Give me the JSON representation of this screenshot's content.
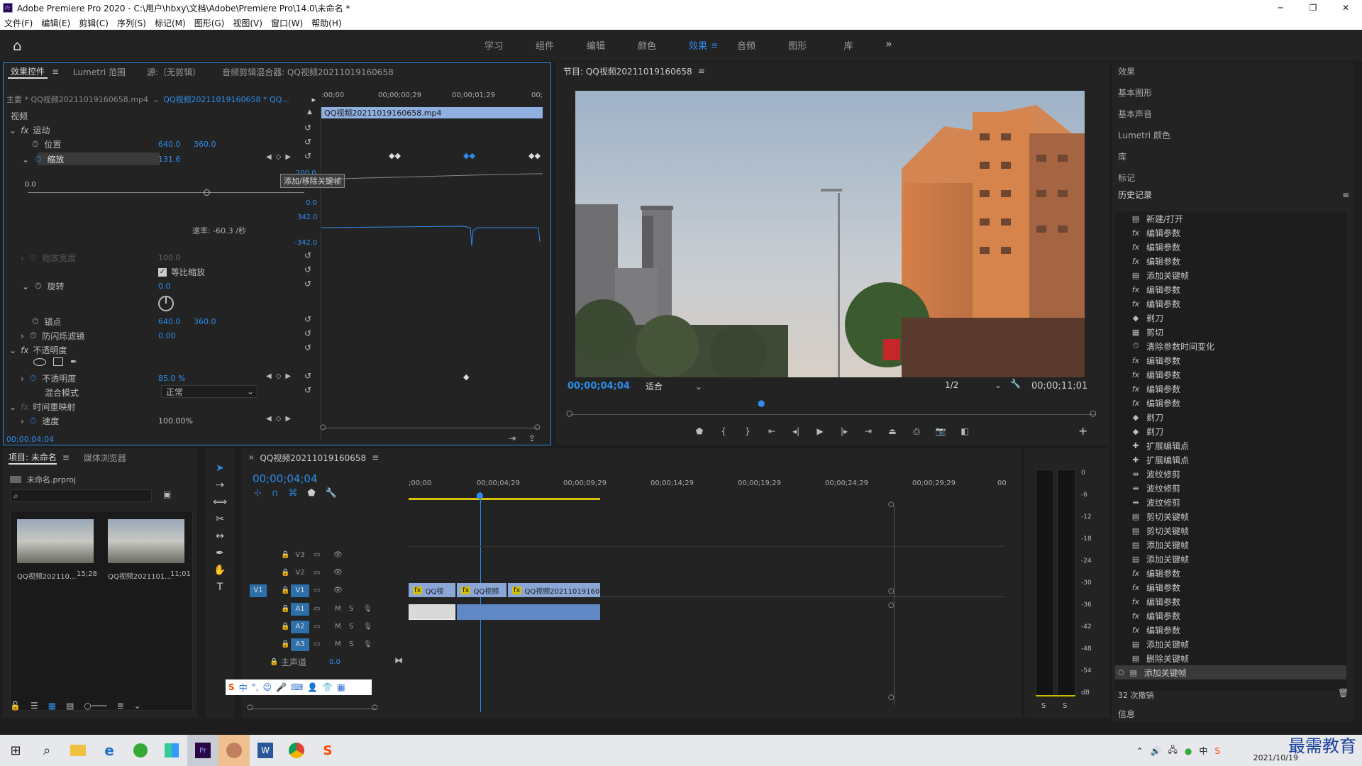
{
  "window": {
    "title": "Adobe Premiere Pro 2020 - C:\\用户\\hbxy\\文档\\Adobe\\Premiere Pro\\14.0\\未命名 *"
  },
  "menu": [
    "文件(F)",
    "编辑(E)",
    "剪辑(C)",
    "序列(S)",
    "标记(M)",
    "图形(G)",
    "视图(V)",
    "窗口(W)",
    "帮助(H)"
  ],
  "workspaces": [
    "学习",
    "组件",
    "编辑",
    "颜色",
    "效果",
    "音频",
    "图形",
    "库"
  ],
  "active_workspace": "效果",
  "effect_controls": {
    "tabs": [
      "效果控件",
      "Lumetri 范围",
      "源:（无剪辑）",
      "音频剪辑混合器: QQ视频20211019160658"
    ],
    "master": "主要 * QQ视频20211019160658.mp4",
    "clip": "QQ视频20211019160658 * QQ...",
    "ruler": [
      ":00;00",
      "00;00;00;29",
      "00;00;01;29",
      "00;"
    ],
    "clip_bar": "QQ视频20211019160658.mp4",
    "video_label": "视频",
    "motion": "运动",
    "position": {
      "label": "位置",
      "x": "640.0",
      "y": "360.0"
    },
    "scale": {
      "label": "缩放",
      "value": "131.6"
    },
    "graph": {
      "zero": "0.0",
      "v1": "0.0",
      "v2": "342.0",
      "v3": "-342.0",
      "top": "200.0",
      "rate": "速率: -60.3 /秒"
    },
    "tooltip": "添加/移除关键帧",
    "scale_width": {
      "label": "缩放宽度",
      "value": "100.0"
    },
    "uniform": "等比缩放",
    "rotation": {
      "label": "旋转",
      "value": "0.0"
    },
    "anchor": {
      "label": "锚点",
      "x": "640.0",
      "y": "360.0"
    },
    "flicker": {
      "label": "防闪烁滤镜",
      "value": "0.00"
    },
    "opacity_group": "不透明度",
    "opacity": {
      "label": "不透明度",
      "value": "85.0 %"
    },
    "blend": {
      "label": "混合模式",
      "value": "正常"
    },
    "remap": "时间重映射",
    "speed": {
      "label": "速度",
      "value": "100.00%"
    },
    "timecode": "00;00;04;04"
  },
  "program": {
    "title": "节目: QQ视频20211019160658",
    "timecode": "00;00;04;04",
    "fit": "适合",
    "res": "1/2",
    "duration": "00;00;11;01"
  },
  "right_panel": {
    "items": [
      "效果",
      "基本图形",
      "基本声音",
      "Lumetri 颜色",
      "库",
      "标记"
    ],
    "history_title": "历史记录",
    "history": [
      {
        "icon": "doc",
        "label": "新建/打开"
      },
      {
        "icon": "fx",
        "label": "编辑参数"
      },
      {
        "icon": "fx",
        "label": "编辑参数"
      },
      {
        "icon": "fx",
        "label": "编辑参数"
      },
      {
        "icon": "key",
        "label": "添加关键帧"
      },
      {
        "icon": "fx",
        "label": "编辑参数"
      },
      {
        "icon": "fx",
        "label": "编辑参数"
      },
      {
        "icon": "razor",
        "label": "剃刀"
      },
      {
        "icon": "cut",
        "label": "剪切"
      },
      {
        "icon": "clock",
        "label": "清除参数时间变化"
      },
      {
        "icon": "fx",
        "label": "编辑参数"
      },
      {
        "icon": "fx",
        "label": "编辑参数"
      },
      {
        "icon": "fx",
        "label": "编辑参数"
      },
      {
        "icon": "fx",
        "label": "编辑参数"
      },
      {
        "icon": "razor",
        "label": "剃刀"
      },
      {
        "icon": "razor",
        "label": "剃刀"
      },
      {
        "icon": "extend",
        "label": "扩展编辑点"
      },
      {
        "icon": "extend",
        "label": "扩展编辑点"
      },
      {
        "icon": "ripple",
        "label": "波纹修剪"
      },
      {
        "icon": "ripple",
        "label": "波纹修剪"
      },
      {
        "icon": "ripple",
        "label": "波纹修剪"
      },
      {
        "icon": "key",
        "label": "剪切关键帧"
      },
      {
        "icon": "key",
        "label": "剪切关键帧"
      },
      {
        "icon": "key",
        "label": "添加关键帧"
      },
      {
        "icon": "key",
        "label": "添加关键帧"
      },
      {
        "icon": "fx",
        "label": "编辑参数"
      },
      {
        "icon": "fx",
        "label": "编辑参数"
      },
      {
        "icon": "fx",
        "label": "编辑参数"
      },
      {
        "icon": "fx",
        "label": "编辑参数"
      },
      {
        "icon": "fx",
        "label": "编辑参数"
      },
      {
        "icon": "key",
        "label": "添加关键帧"
      },
      {
        "icon": "key",
        "label": "删除关键帧"
      },
      {
        "icon": "key",
        "label": "添加关键帧"
      }
    ],
    "undo": "32 次撤销",
    "info": "信息"
  },
  "project": {
    "tabs": [
      "项目: 未命名",
      "媒体浏览器"
    ],
    "file": "未命名.prproj",
    "clips": [
      {
        "name": "QQ视频202110...",
        "dur": "15;28"
      },
      {
        "name": "QQ视频2021101...",
        "dur": "11;01"
      }
    ]
  },
  "timeline": {
    "title": "QQ视频20211019160658",
    "timecode": "00;00;04;04",
    "ruler": [
      ";00;00",
      "00;00;04;29",
      "00;00;09;29",
      "00;00;14;29",
      "00;00;19;29",
      "00;00;24;29",
      "00;00;29;29",
      "00"
    ],
    "tracks": [
      "V3",
      "V2",
      "V1",
      "A1",
      "A2",
      "A3"
    ],
    "master": "主声道",
    "master_val": "0.0",
    "clips": [
      "QQ视",
      "QQ视频",
      "QQ视频20211019160"
    ]
  },
  "meter": {
    "labels": [
      "0",
      "-6",
      "-12",
      "-18",
      "-24",
      "-30",
      "-36",
      "-42",
      "-48",
      "-54",
      "dB"
    ]
  },
  "taskbar": {
    "time": "2021/10/19",
    "watermark": "最需教育"
  }
}
